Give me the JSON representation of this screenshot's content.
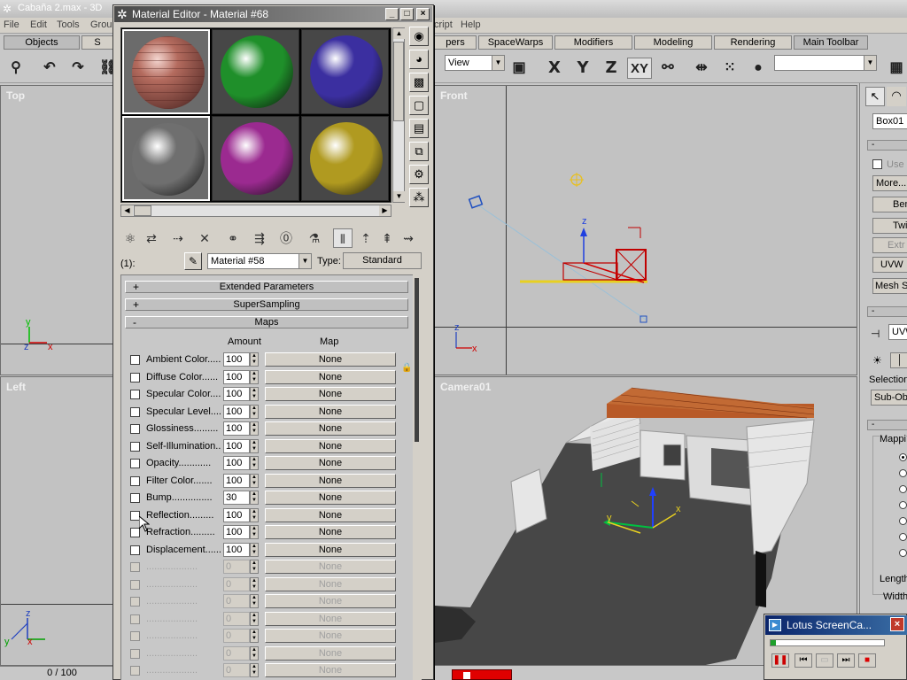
{
  "app": {
    "title": "Cabaña 2.max - 3D",
    "menu": [
      {
        "label": "File",
        "key": "F"
      },
      {
        "label": "Edit",
        "key": "E"
      },
      {
        "label": "Tools",
        "key": "T"
      },
      {
        "label": "Grou",
        "key": "G"
      },
      {
        "label": "cript",
        "key": ""
      },
      {
        "label": "Help",
        "key": "H"
      }
    ]
  },
  "tabs": [
    "Objects",
    "S",
    "pers",
    "SpaceWarps",
    "Modifiers",
    "Modeling",
    "Rendering",
    "Main Toolbar"
  ],
  "toolbar": {
    "view_select": "View",
    "axis_x": "X",
    "axis_y": "Y",
    "axis_z": "Z",
    "axis_xy": "XY",
    "named_selection": ""
  },
  "viewports": {
    "top": "Top",
    "front": "Front",
    "left": "Left",
    "camera": "Camera01"
  },
  "timeline": {
    "frame": "0 / 100"
  },
  "command_panel": {
    "object_name": "Box01",
    "use_label": "Use",
    "more_btn": "More...",
    "mods": [
      "Ben",
      "Twi",
      "Extr",
      "UVW",
      "Mesh S"
    ],
    "stack_item": "UVW",
    "selection_label": "Selection",
    "subobj_btn": "Sub-Obj",
    "mapping_label": "Mappi",
    "length_label": "Length",
    "width_label": "Width"
  },
  "material_editor": {
    "title": "Material Editor - Material #68",
    "slot_colors": [
      "#b46b5e",
      "#1f8f2a",
      "#3b2fa0",
      "#6f6f6f",
      "#9b2a90",
      "#b09a20"
    ],
    "slot_labels": [
      "brick-material-slot",
      "green-material-slot",
      "blue-material-slot",
      "gray-material-slot",
      "purple-material-slot",
      "yellow-material-slot"
    ],
    "level_label": "(1):",
    "material_name": "Material #58",
    "type_label": "Type:",
    "type_value": "Standard",
    "rollouts": {
      "extended": "Extended Parameters",
      "supersampling": "SuperSampling",
      "maps": "Maps",
      "extended_sign": "+",
      "supersampling_sign": "+",
      "maps_sign": "-"
    },
    "columns": {
      "amount": "Amount",
      "map": "Map"
    },
    "maps": [
      {
        "name": "Ambient Color......",
        "amount": "100",
        "map": "None",
        "enabled": true
      },
      {
        "name": "Diffuse Color......",
        "amount": "100",
        "map": "None",
        "enabled": true
      },
      {
        "name": "Specular Color.....",
        "amount": "100",
        "map": "None",
        "enabled": true
      },
      {
        "name": "Specular Level.....",
        "amount": "100",
        "map": "None",
        "enabled": true
      },
      {
        "name": "Glossiness.........",
        "amount": "100",
        "map": "None",
        "enabled": true
      },
      {
        "name": "Self-Illumination..",
        "amount": "100",
        "map": "None",
        "enabled": true
      },
      {
        "name": "Opacity............",
        "amount": "100",
        "map": "None",
        "enabled": true
      },
      {
        "name": "Filter Color.......",
        "amount": "100",
        "map": "None",
        "enabled": true
      },
      {
        "name": "Bump...............",
        "amount": "30",
        "map": "None",
        "enabled": true
      },
      {
        "name": "Reflection.........",
        "amount": "100",
        "map": "None",
        "enabled": true
      },
      {
        "name": "Refraction.........",
        "amount": "100",
        "map": "None",
        "enabled": true
      },
      {
        "name": "Displacement.......",
        "amount": "100",
        "map": "None",
        "enabled": true
      },
      {
        "name": "...................",
        "amount": "0",
        "map": "None",
        "enabled": false
      },
      {
        "name": "...................",
        "amount": "0",
        "map": "None",
        "enabled": false
      },
      {
        "name": "...................",
        "amount": "0",
        "map": "None",
        "enabled": false
      },
      {
        "name": "...................",
        "amount": "0",
        "map": "None",
        "enabled": false
      },
      {
        "name": "...................",
        "amount": "0",
        "map": "None",
        "enabled": false
      },
      {
        "name": "...................",
        "amount": "0",
        "map": "None",
        "enabled": false
      },
      {
        "name": "...................",
        "amount": "0",
        "map": "None",
        "enabled": false
      }
    ]
  },
  "lotus": {
    "title": "Lotus ScreenCa...",
    "progress": 0.05
  }
}
